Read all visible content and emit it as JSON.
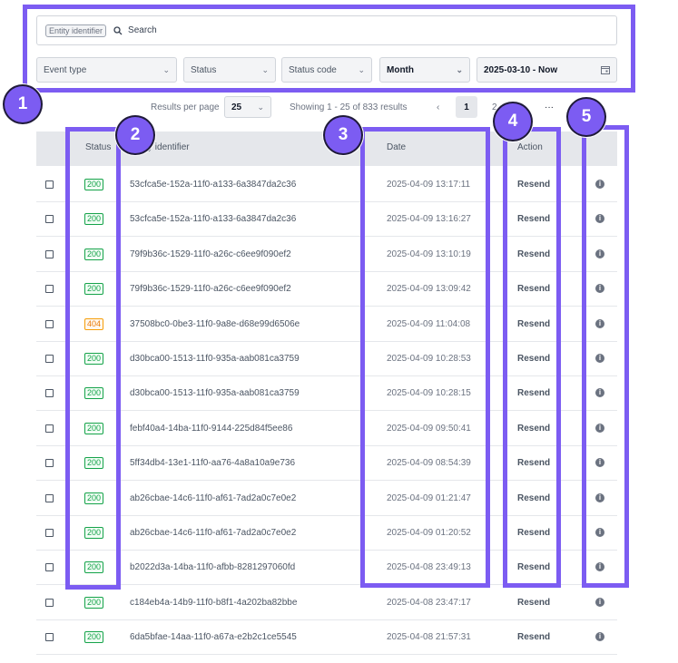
{
  "search": {
    "chip": "Entity identifier",
    "label": "Search"
  },
  "filters": [
    {
      "label": "Event type"
    },
    {
      "label": "Status"
    },
    {
      "label": "Status code"
    },
    {
      "label": "Month"
    },
    {
      "label": "2025-03-10 - Now"
    }
  ],
  "pager": {
    "results_per_page_label": "Results per page",
    "per_page": "25",
    "showing": "Showing 1 - 25 of 833 results",
    "prev": "‹",
    "current_page": "1",
    "page2": "2",
    "ellipsis": "···"
  },
  "table": {
    "headers": {
      "status": "Status",
      "entity": "Entity identifier",
      "date": "Date",
      "action": "Action"
    },
    "rows": [
      {
        "status": "200",
        "id": "53cfca5e-152a-11f0-a133-6a3847da2c36",
        "date": "2025-04-09 13:17:11",
        "action": "Resend"
      },
      {
        "status": "200",
        "id": "53cfca5e-152a-11f0-a133-6a3847da2c36",
        "date": "2025-04-09 13:16:27",
        "action": "Resend"
      },
      {
        "status": "200",
        "id": "79f9b36c-1529-11f0-a26c-c6ee9f090ef2",
        "date": "2025-04-09 13:10:19",
        "action": "Resend"
      },
      {
        "status": "200",
        "id": "79f9b36c-1529-11f0-a26c-c6ee9f090ef2",
        "date": "2025-04-09 13:09:42",
        "action": "Resend"
      },
      {
        "status": "404",
        "id": "37508bc0-0be3-11f0-9a8e-d68e99d6506e",
        "date": "2025-04-09 11:04:08",
        "action": "Resend"
      },
      {
        "status": "200",
        "id": "d30bca00-1513-11f0-935a-aab081ca3759",
        "date": "2025-04-09 10:28:53",
        "action": "Resend"
      },
      {
        "status": "200",
        "id": "d30bca00-1513-11f0-935a-aab081ca3759",
        "date": "2025-04-09 10:28:15",
        "action": "Resend"
      },
      {
        "status": "200",
        "id": "febf40a4-14ba-11f0-9144-225d84f5ee86",
        "date": "2025-04-09 09:50:41",
        "action": "Resend"
      },
      {
        "status": "200",
        "id": "5ff34db4-13e1-11f0-aa76-4a8a10a9e736",
        "date": "2025-04-09 08:54:39",
        "action": "Resend"
      },
      {
        "status": "200",
        "id": "ab26cbae-14c6-11f0-af61-7ad2a0c7e0e2",
        "date": "2025-04-09 01:21:47",
        "action": "Resend"
      },
      {
        "status": "200",
        "id": "ab26cbae-14c6-11f0-af61-7ad2a0c7e0e2",
        "date": "2025-04-09 01:20:52",
        "action": "Resend"
      },
      {
        "status": "200",
        "id": "b2022d3a-14ba-11f0-afbb-8281297060fd",
        "date": "2025-04-08 23:49:13",
        "action": "Resend"
      },
      {
        "status": "200",
        "id": "c184eb4a-14b9-11f0-b8f1-4a202ba82bbe",
        "date": "2025-04-08 23:47:17",
        "action": "Resend"
      },
      {
        "status": "200",
        "id": "6da5bfae-14aa-11f0-a67a-e2b2c1ce5545",
        "date": "2025-04-08 21:57:31",
        "action": "Resend"
      }
    ]
  },
  "annotations": [
    "1",
    "2",
    "3",
    "4",
    "5"
  ],
  "colors": {
    "annotation": "#7c5cf2",
    "ok": "#16a34a",
    "warn": "#f59e0b"
  }
}
